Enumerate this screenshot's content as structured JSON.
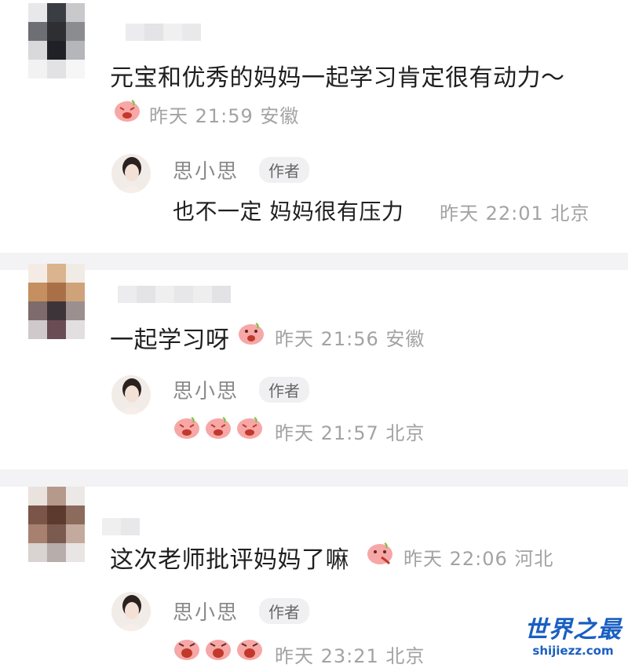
{
  "comments": [
    {
      "text": "元宝和优秀的妈妈一起学习肯定很有动力～",
      "meta": "昨天 21:59 安徽",
      "reply": {
        "author": "思小思",
        "badge": "作者",
        "text": "也不一定 妈妈很有压力",
        "meta": "昨天 22:01 北京"
      }
    },
    {
      "text": "一起学习呀",
      "meta": "昨天 21:56 安徽",
      "reply": {
        "author": "思小思",
        "badge": "作者",
        "text": "",
        "meta": "昨天 21:57 北京"
      }
    },
    {
      "text": "这次老师批评妈妈了嘛",
      "meta": "昨天 22:06 河北",
      "reply": {
        "author": "思小思",
        "badge": "作者",
        "text": "",
        "meta": "昨天 23:21 北京"
      }
    }
  ],
  "icons": {
    "comment_emoji": "pink-pig-face-icon",
    "author_avatar": "woman-portrait-avatar"
  },
  "colors": {
    "background": "#ffffff",
    "separator": "#f3f3f5",
    "meta_text": "#a3a3a3",
    "pig_pink": "#f6a7a6",
    "watermark": "#1a5fc2"
  },
  "watermark": {
    "title": "世界之最",
    "site": "shijiezz.com"
  }
}
